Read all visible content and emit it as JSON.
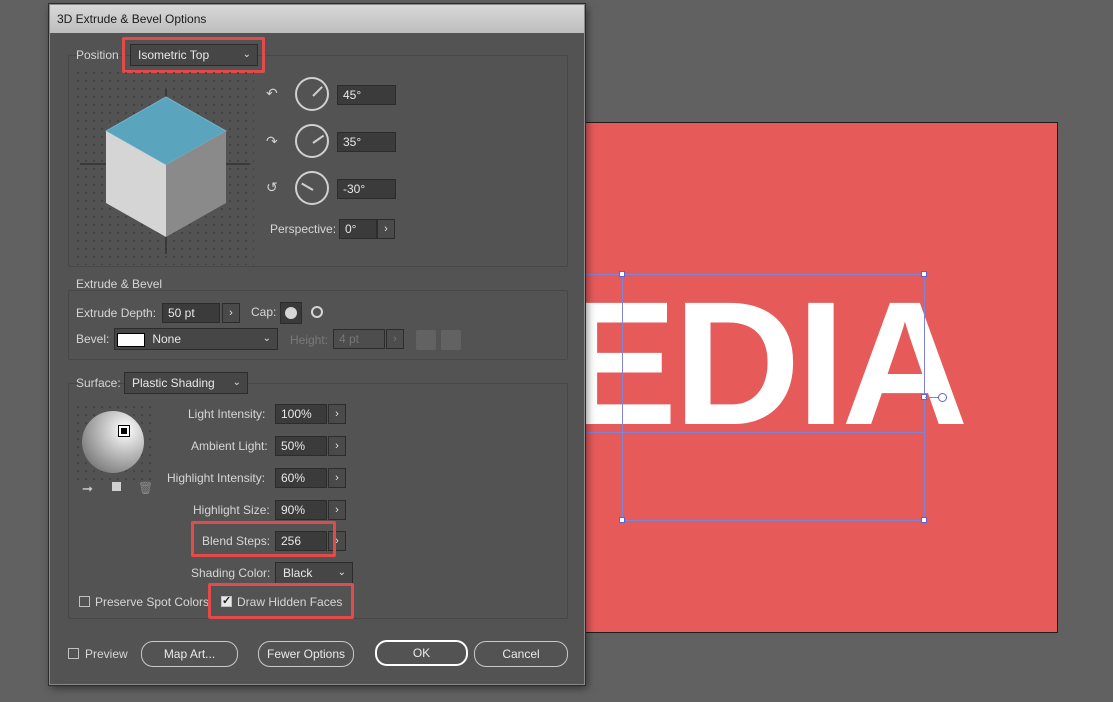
{
  "dialog": {
    "title": "3D Extrude & Bevel Options",
    "position": {
      "label": "Position",
      "preset": "Isometric Top",
      "rot_x": "45°",
      "rot_y": "35°",
      "rot_z": "-30°",
      "perspective_label": "Perspective:",
      "perspective": "0°"
    },
    "extrude": {
      "section_label": "Extrude & Bevel",
      "depth_label": "Extrude Depth:",
      "depth": "50 pt",
      "cap_label": "Cap:",
      "bevel_label": "Bevel:",
      "bevel": "None",
      "height_label": "Height:",
      "height": "4 pt"
    },
    "surface": {
      "label": "Surface:",
      "value": "Plastic Shading",
      "light_intensity_label": "Light Intensity:",
      "light_intensity": "100%",
      "ambient_label": "Ambient Light:",
      "ambient": "50%",
      "highlight_intensity_label": "Highlight Intensity:",
      "highlight_intensity": "60%",
      "highlight_size_label": "Highlight Size:",
      "highlight_size": "90%",
      "blend_steps_label": "Blend Steps:",
      "blend_steps": "256",
      "shading_color_label": "Shading Color:",
      "shading_color": "Black"
    },
    "preserve_spot_colors": "Preserve Spot Colors",
    "draw_hidden_faces": "Draw Hidden Faces",
    "buttons": {
      "preview": "Preview",
      "map_art": "Map Art...",
      "fewer_options": "Fewer Options",
      "ok": "OK",
      "cancel": "Cancel"
    }
  },
  "artwork": {
    "text": "EDIA",
    "background_color": "#e65a5a"
  },
  "colors": {
    "highlight_border": "#e34b4b",
    "cube_top": "#5ba4bd",
    "dialog_bg": "#535353"
  }
}
